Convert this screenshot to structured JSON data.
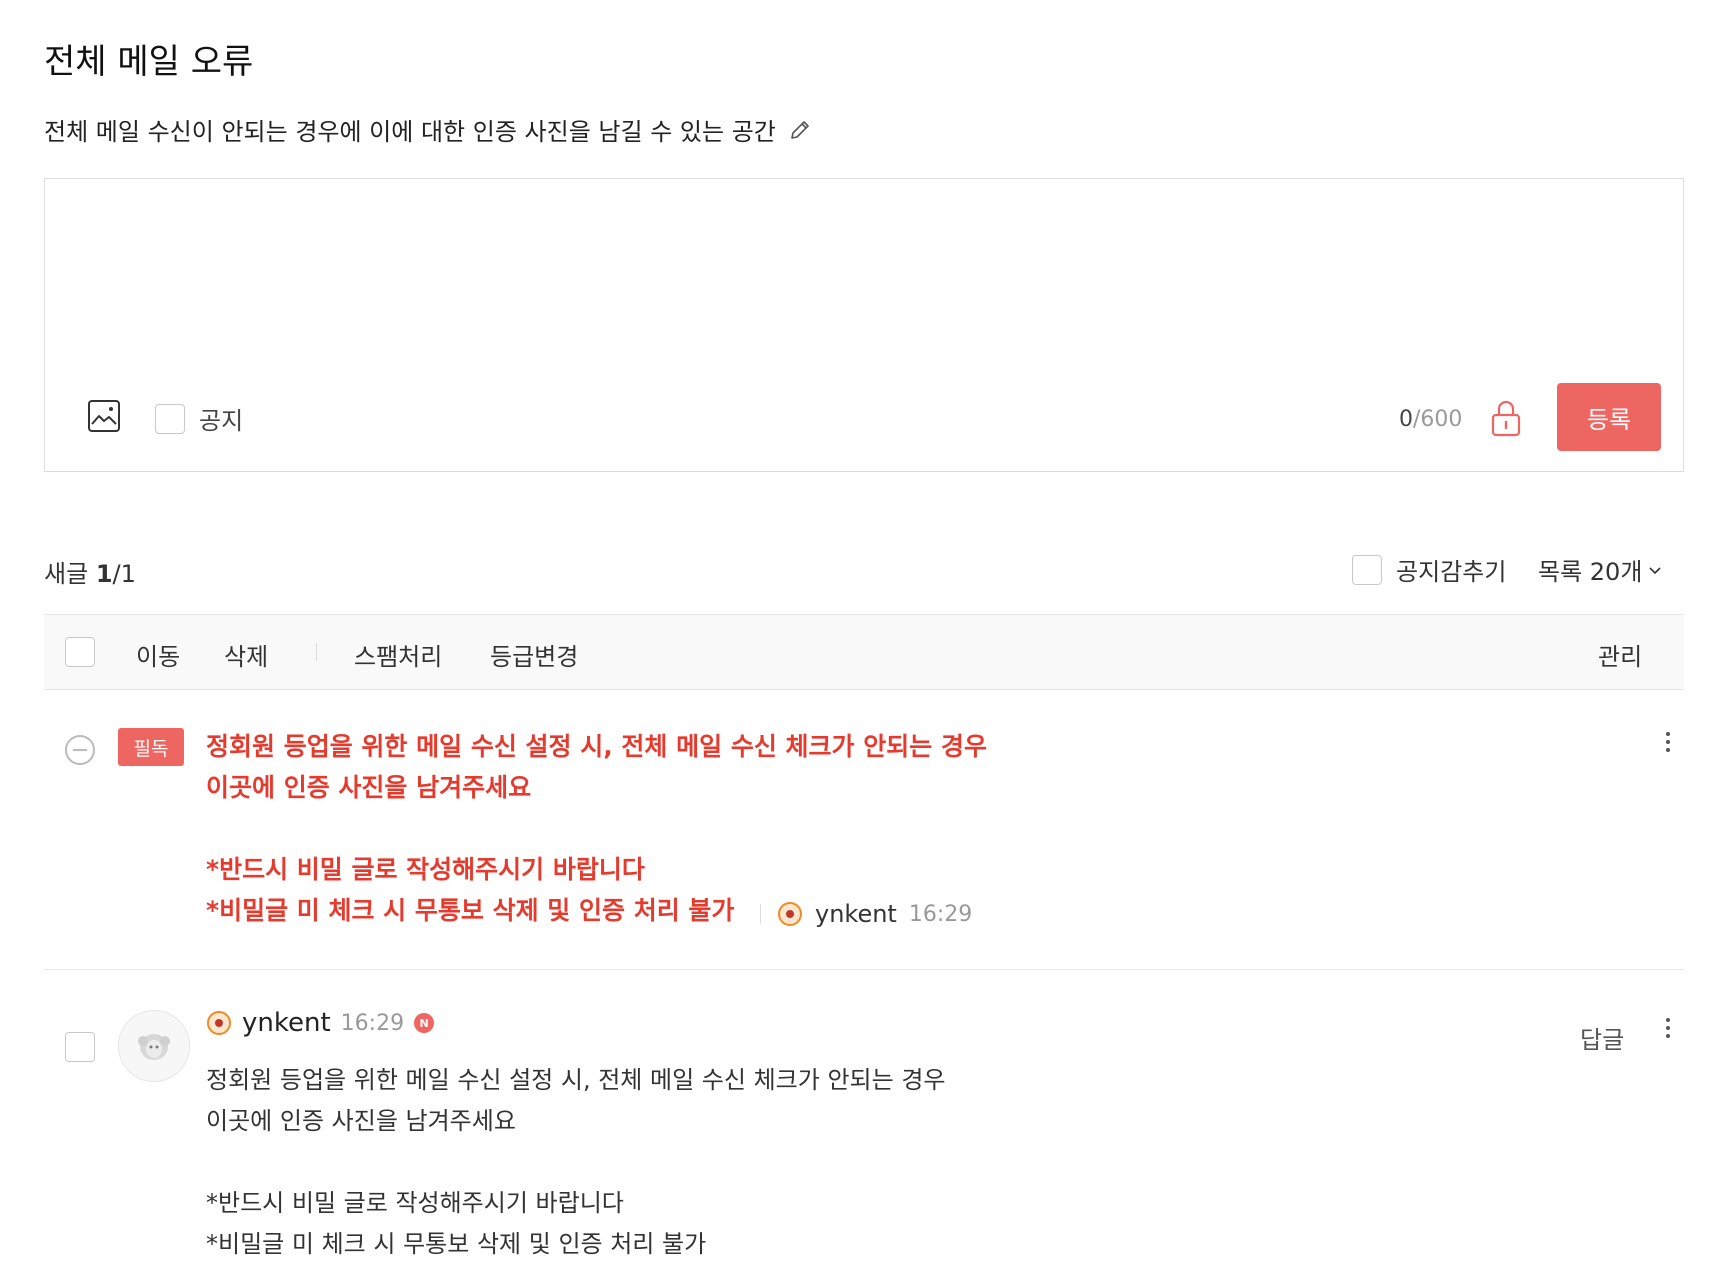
{
  "board": {
    "title": "전체 메일 오류",
    "description": "전체 메일 수신이 안되는 경우에 이에 대한 인증 사진을 남길 수 있는 공간"
  },
  "editor": {
    "notice_label": "공지",
    "counter_current": "0",
    "counter_max": "/600",
    "submit_label": "등록"
  },
  "list_header": {
    "new_label": "새글",
    "new_count": "1",
    "total": "/1",
    "hide_notice_label": "공지감추기",
    "list_size_label": "목록 20개"
  },
  "toolbar": {
    "move_label": "이동",
    "delete_label": "삭제",
    "spam_label": "스팸처리",
    "grade_label": "등급변경",
    "manage_label": "관리"
  },
  "notice_post": {
    "badge": "필독",
    "lines": [
      "정회원 등업을 위한 메일 수신 설정 시, 전체 메일 수신 체크가 안되는 경우",
      "이곳에 인증 사진을 남겨주세요",
      "",
      "*반드시 비밀 글로 작성해주시기 바랍니다",
      "*비밀글 미 체크 시 무통보 삭제 및 인증 처리 불가"
    ],
    "author": "ynkent",
    "time": "16:29"
  },
  "comment_post": {
    "author": "ynkent",
    "time": "16:29",
    "new_badge": "N",
    "reply_label": "답글",
    "lines": [
      "정회원 등업을 위한 메일 수신 설정 시, 전체 메일 수신 체크가 안되는 경우",
      "이곳에 인증 사진을 남겨주세요",
      "",
      "*반드시 비밀 글로 작성해주시기 바랍니다",
      "*비밀글 미 체크 시 무통보 삭제 및 인증 처리 불가"
    ]
  },
  "colors": {
    "accent": "#ee6661",
    "notice_text": "#e53b2f",
    "badge_orange": "#f08a24"
  },
  "icons": [
    "pencil-icon",
    "image-icon",
    "lock-icon",
    "chevron-down-icon",
    "minus-circle-icon",
    "more-vertical-icon",
    "donut-badge-icon",
    "sheep-avatar-icon"
  ]
}
